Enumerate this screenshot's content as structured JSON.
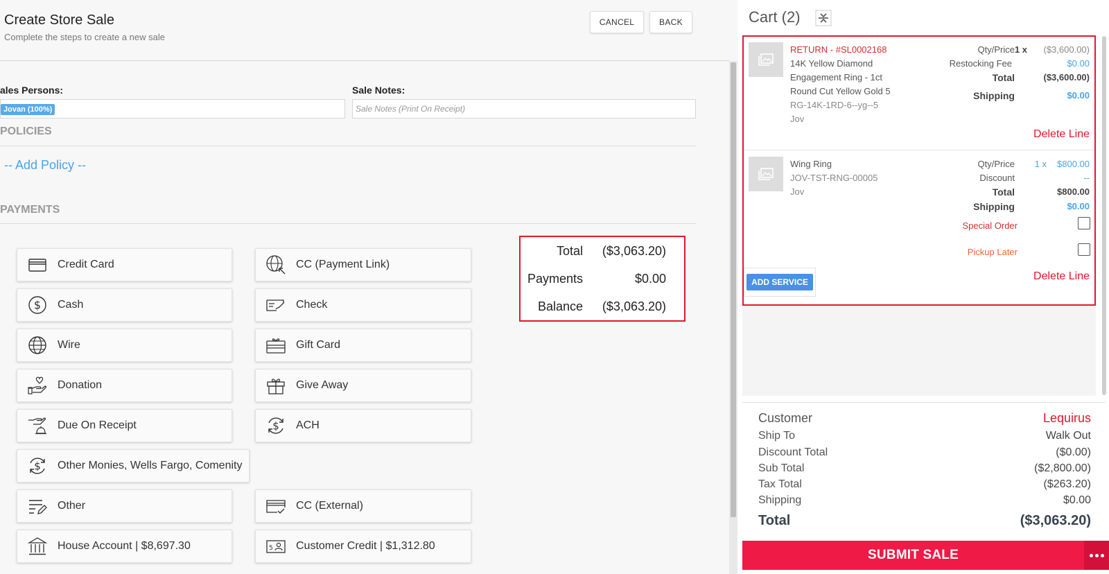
{
  "header": {
    "title": "Create Store Sale",
    "subtitle": "Complete the steps to create a new sale",
    "cancel_label": "CANCEL",
    "back_label": "BACK"
  },
  "fields": {
    "sales_persons_label": "ales Persons:",
    "sales_person_chip": "Jovan (100%)",
    "sale_notes_label": "Sale Notes:",
    "sale_notes_placeholder": "Sale Notes (Print On Receipt)"
  },
  "policies": {
    "title": "POLICIES",
    "add_policy": "-- Add Policy --"
  },
  "payments": {
    "title": "PAYMENTS",
    "methods": [
      {
        "label": "Credit Card",
        "icon": "credit-card-icon"
      },
      {
        "label": "CC (Payment Link)",
        "icon": "globe-link-icon"
      },
      {
        "label": "Cash",
        "icon": "dollar-circle-icon"
      },
      {
        "label": "Check",
        "icon": "check-icon"
      },
      {
        "label": "Wire",
        "icon": "globe-icon"
      },
      {
        "label": "Gift Card",
        "icon": "gift-card-icon"
      },
      {
        "label": "Donation",
        "icon": "heart-hand-icon"
      },
      {
        "label": "Give Away",
        "icon": "gift-icon"
      },
      {
        "label": "Due On Receipt",
        "icon": "hand-bell-icon"
      },
      {
        "label": "ACH",
        "icon": "dollar-cycle-icon"
      },
      {
        "label": "Other Monies, Wells Fargo, Comenity",
        "icon": "dollar-cycle-icon"
      },
      {
        "label": "Other",
        "icon": "list-pen-icon"
      },
      {
        "label": "CC (External)",
        "icon": "card-check-icon"
      },
      {
        "label": "House Account | $8,697.30",
        "icon": "bank-icon"
      },
      {
        "label": "Customer Credit | $1,312.80",
        "icon": "id-card-icon"
      }
    ]
  },
  "totals": {
    "total_label": "Total",
    "total_value": "($3,063.20)",
    "payments_label": "Payments",
    "payments_value": "$0.00",
    "balance_label": "Balance",
    "balance_value": "($3,063.20)"
  },
  "cart": {
    "title": "Cart (2)",
    "items": [
      {
        "tag": "RETURN - #SL0002168",
        "name_lines": [
          "14K Yellow Diamond",
          "Engagement Ring - 1ct",
          "Round Cut Yellow Gold 5"
        ],
        "sku": "RG-14K-1RD-6--yg--5",
        "person": "Jov",
        "qty_price_label": "Qty/Price",
        "qty": "1 x",
        "price": "($3,600.00)",
        "fee_label": "Restocking Fee",
        "fee_value": "$0.00",
        "total_label": "Total",
        "total_value": "($3,600.00)",
        "shipping_label": "Shipping",
        "shipping_value": "$0.00",
        "delete_label": "Delete Line"
      },
      {
        "name": "Wing Ring",
        "sku": "JOV-TST-RNG-00005",
        "person": "Jov",
        "qty_price_label": "Qty/Price",
        "qty": "1 x",
        "price": "$800.00",
        "discount_label": "Discount",
        "discount_value": "--",
        "total_label": "Total",
        "total_value": "$800.00",
        "shipping_label": "Shipping",
        "shipping_value": "$0.00",
        "special_order_label": "Special Order",
        "pickup_later_label": "Pickup Later",
        "add_service_label": "ADD SERVICE",
        "delete_label": "Delete Line"
      }
    ],
    "summary": {
      "customer_label": "Customer",
      "customer_value": "Lequirus",
      "ship_to_label": "Ship To",
      "ship_to_value": "Walk Out",
      "discount_total_label": "Discount Total",
      "discount_total_value": "($0.00)",
      "sub_total_label": "Sub Total",
      "sub_total_value": "($2,800.00)",
      "tax_total_label": "Tax Total",
      "tax_total_value": "($263.20)",
      "shipping_label": "Shipping",
      "shipping_value": "$0.00",
      "total_label": "Total",
      "total_value": "($3,063.20)"
    },
    "submit_label": "SUBMIT SALE"
  },
  "colors": {
    "accent_red": "#e3162b",
    "submit_red": "#f01a46",
    "link_blue": "#4aa3ea",
    "button_blue": "#4b90e2"
  }
}
